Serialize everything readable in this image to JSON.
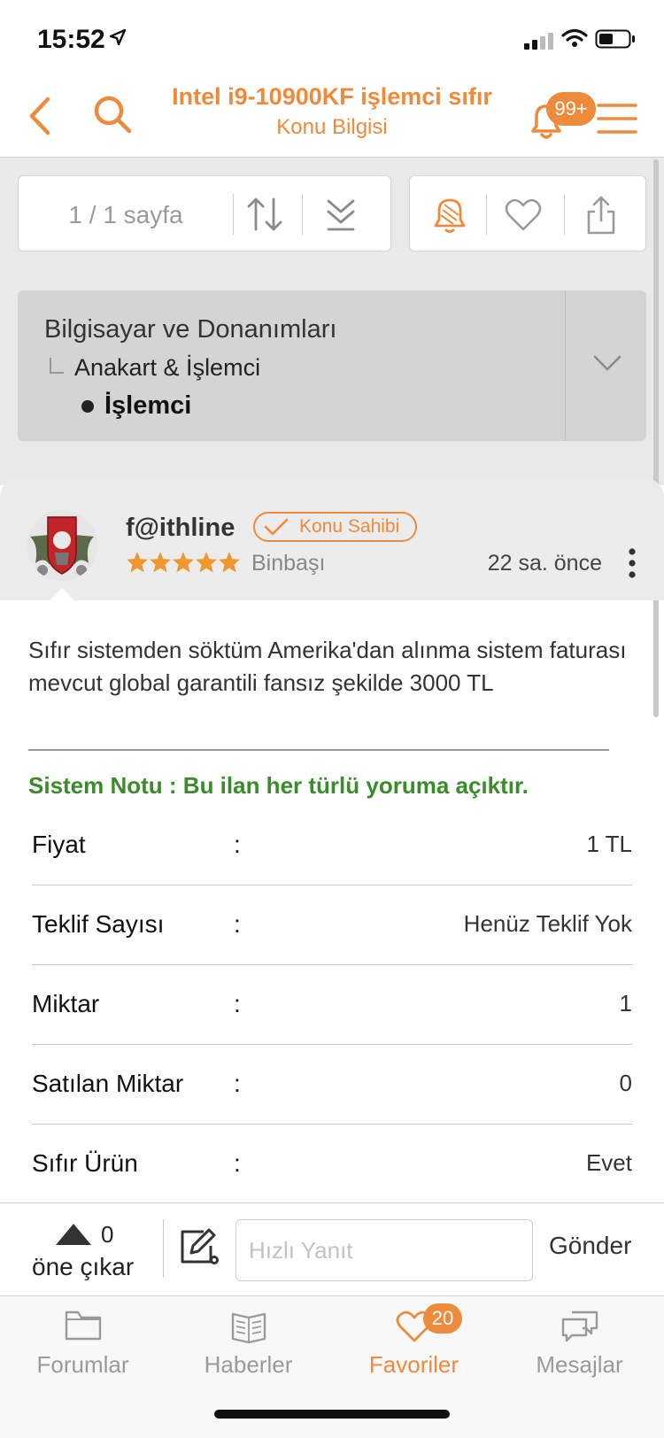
{
  "status_bar": {
    "time": "15:52"
  },
  "nav": {
    "title": "Intel i9-10900KF işlemci sıfır",
    "subtitle": "Konu Bilgisi",
    "notification_badge": "99+"
  },
  "toolbar": {
    "page_info": "1 / 1 sayfa"
  },
  "breadcrumb": {
    "level1": "Bilgisayar ve Donanımları",
    "level2": "Anakart & İşlemci",
    "level3": "İşlemci"
  },
  "post": {
    "username": "f@ithline",
    "owner_badge": "Konu Sahibi",
    "rating_stars": 5,
    "rank": "Binbaşı",
    "time": "22 sa. önce",
    "body": "Sıfır sistemden söktüm Amerika'dan alınma sistem faturası mevcut global garantili fansız şekilde 3000 TL",
    "system_note": "Sistem Notu : Bu ilan her türlü yoruma açıktır."
  },
  "info_rows": [
    {
      "label": "Fiyat",
      "sep": ":",
      "value": "1 TL"
    },
    {
      "label": "Teklif Sayısı",
      "sep": ":",
      "value": "Henüz Teklif Yok"
    },
    {
      "label": "Miktar",
      "sep": ":",
      "value": "1"
    },
    {
      "label": "Satılan Miktar",
      "sep": ":",
      "value": "0"
    },
    {
      "label": "Sıfır Ürün",
      "sep": ":",
      "value": "Evet"
    }
  ],
  "reply": {
    "upvote_count": "0",
    "upvote_label": "öne çıkar",
    "placeholder": "Hızlı Yanıt",
    "send_label": "Gönder"
  },
  "tabs": [
    {
      "label": "Forumlar",
      "icon": "folder-icon",
      "active": false
    },
    {
      "label": "Haberler",
      "icon": "newspaper-icon",
      "active": false
    },
    {
      "label": "Favoriler",
      "icon": "heart-icon",
      "active": true,
      "badge": "20"
    },
    {
      "label": "Mesajlar",
      "icon": "messages-icon",
      "active": false
    }
  ],
  "colors": {
    "accent": "#ee8a3c",
    "note_green": "#3a8c2a",
    "gray_bg": "#e9e9e9"
  }
}
